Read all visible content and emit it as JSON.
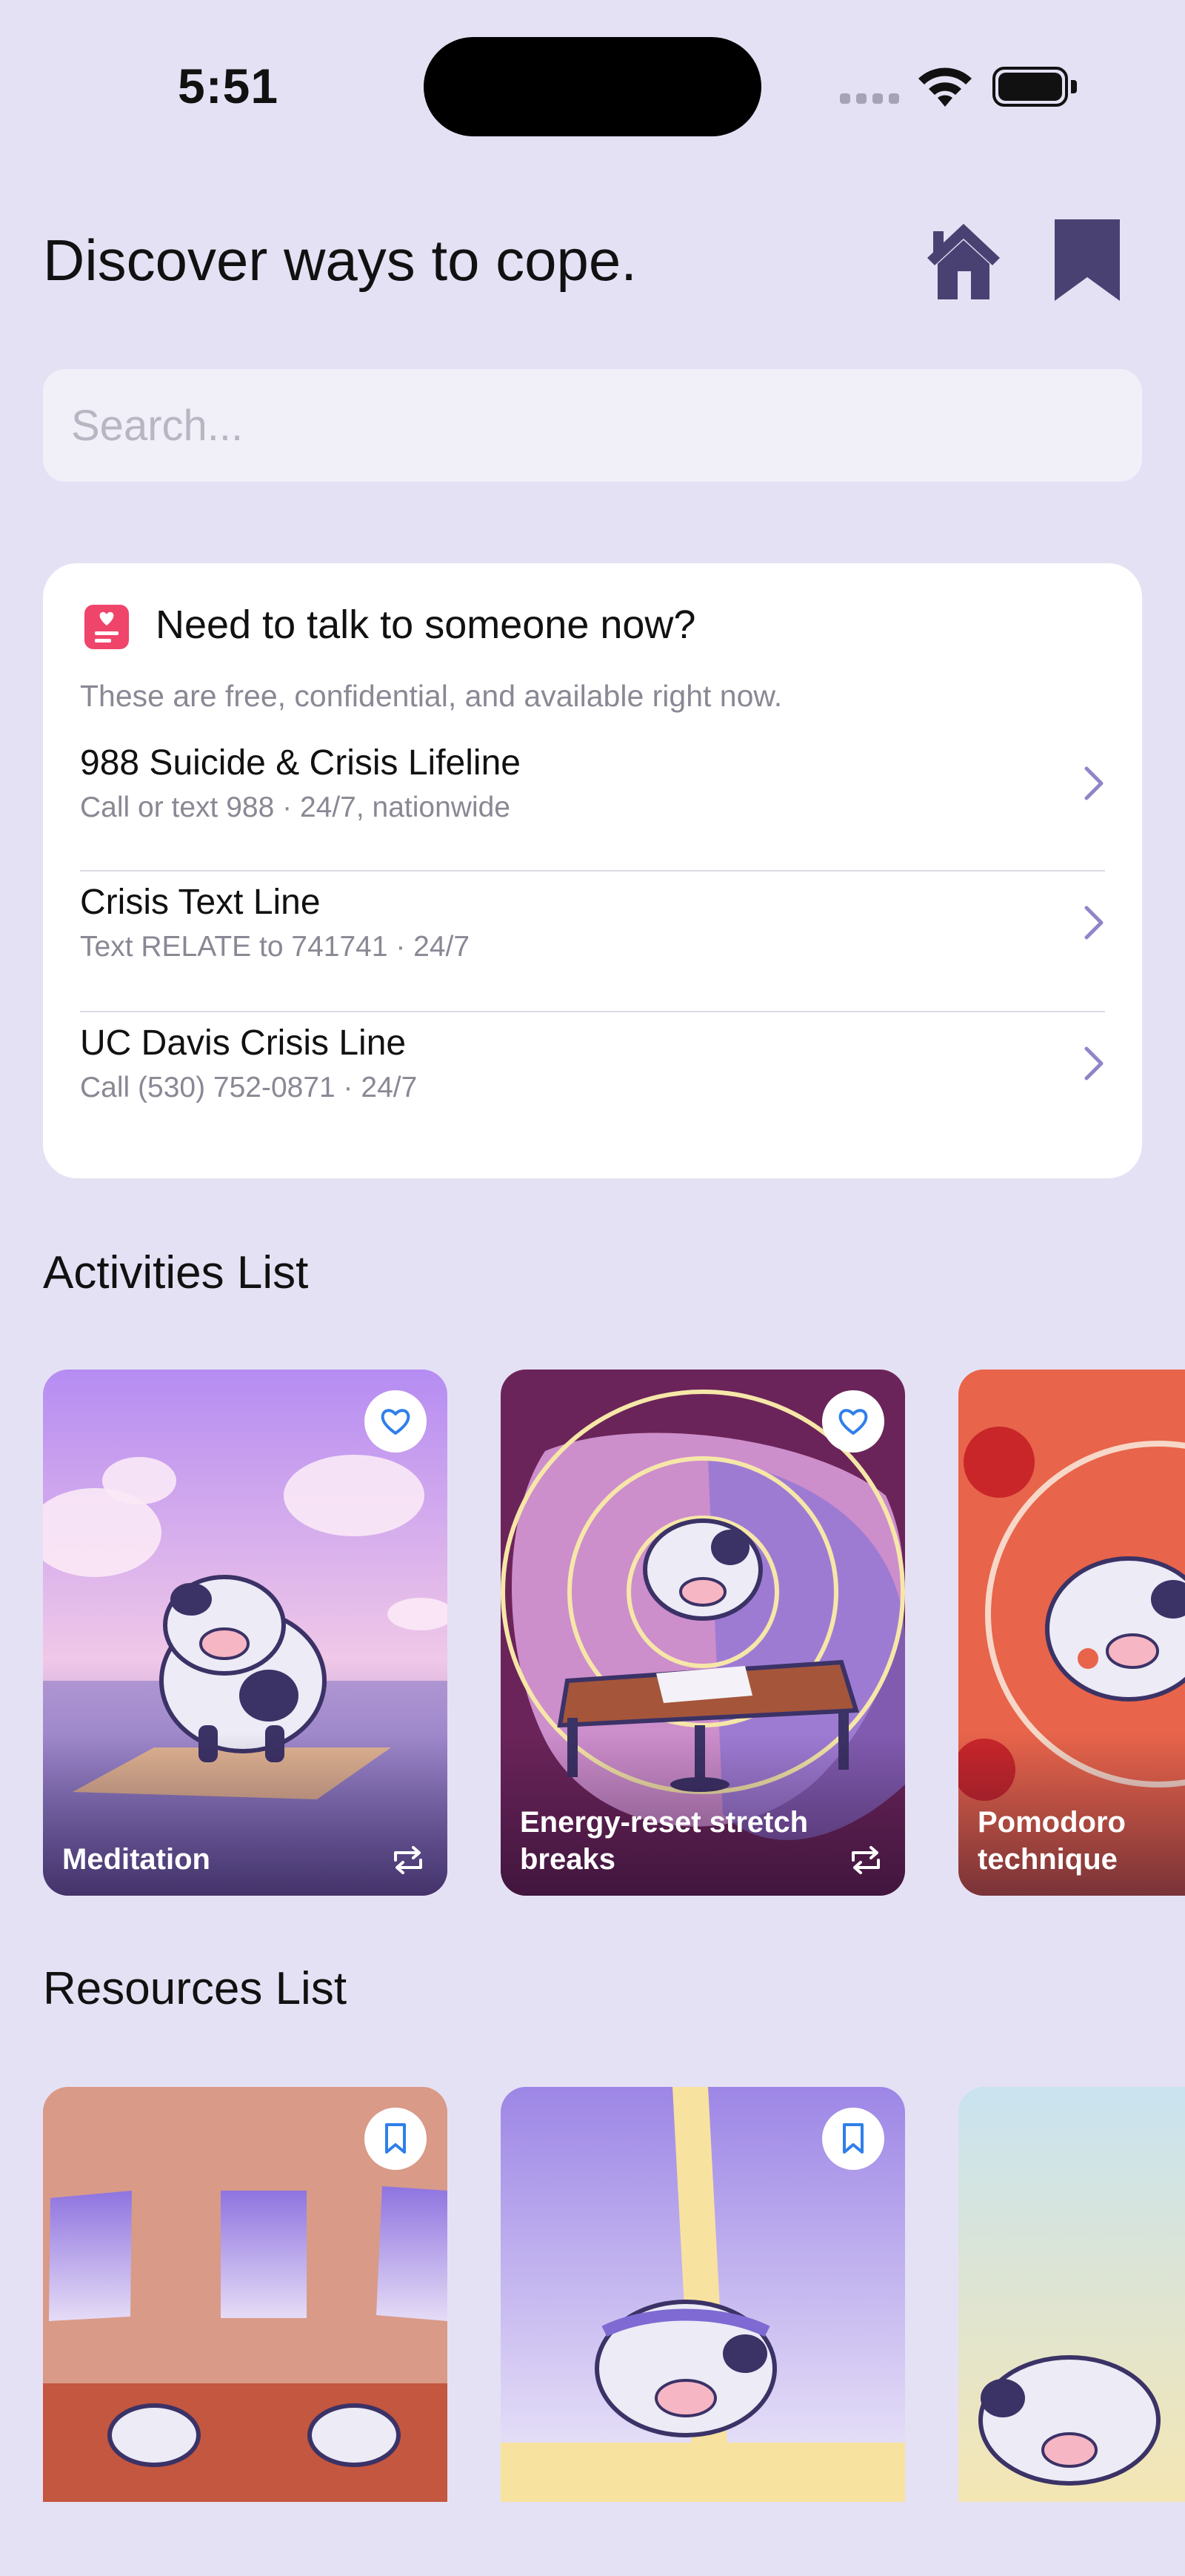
{
  "status_bar": {
    "time": "5:51",
    "icons": [
      "signal-icon",
      "wifi-icon",
      "battery-icon"
    ]
  },
  "header": {
    "title": "Discover ways to cope.",
    "home_icon": "home-icon",
    "bookmark_icon": "bookmark-icon",
    "accent_color": "#4a4173"
  },
  "search": {
    "placeholder": "Search...",
    "value": ""
  },
  "crisis": {
    "title": "Need to talk to someone now?",
    "subtitle": "These are free, confidential, and available right now.",
    "icon": "heart-note-icon",
    "icon_color": "#f0456b",
    "hotlines": [
      {
        "name": "988 Suicide & Crisis Lifeline",
        "detail": "Call or text 988 · 24/7, nationwide"
      },
      {
        "name": "Crisis Text Line",
        "detail": "Text RELATE to 741741 · 24/7"
      },
      {
        "name": "UC Davis Crisis Line",
        "detail": "Call (530) 752-0871 · 24/7"
      }
    ]
  },
  "activities": {
    "heading": "Activities List",
    "items": [
      {
        "label": "Meditation",
        "favorite_icon": "heart-icon",
        "repeat_icon": "repeat-icon"
      },
      {
        "label": "Energy-reset stretch breaks",
        "favorite_icon": "heart-icon",
        "repeat_icon": "repeat-icon"
      },
      {
        "label": "Pomodoro technique"
      }
    ]
  },
  "resources": {
    "heading": "Resources List",
    "items": [
      {
        "bookmark_icon": "bookmark-icon"
      },
      {
        "bookmark_icon": "bookmark-icon"
      },
      {}
    ]
  }
}
